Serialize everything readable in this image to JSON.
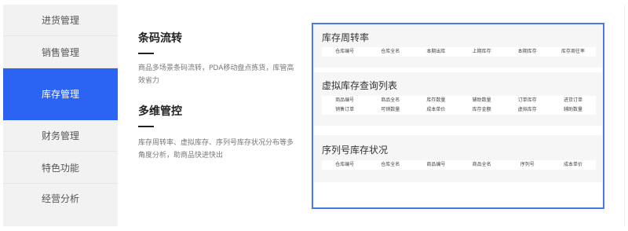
{
  "sidebar": {
    "items": [
      {
        "label": "进货管理"
      },
      {
        "label": "销售管理"
      },
      {
        "label": "库存管理"
      },
      {
        "label": "财务管理"
      },
      {
        "label": "特色功能"
      },
      {
        "label": "经营分析"
      }
    ],
    "active_label": "库存管理"
  },
  "features": [
    {
      "title": "条码流转",
      "desc": "商品多场景条码流转，PDA移动盘点拣货，库管高效省力"
    },
    {
      "title": "多维管控",
      "desc": "库存周转率、虚拟库存、序列号库存状况分布等多角度分析，助商品快进快出"
    }
  ],
  "reports": [
    {
      "title": "库存周转率",
      "rows": [
        [
          "仓库编号",
          "仓库全名",
          "本期出库",
          "上期库存",
          "本期库存",
          "库存周往率"
        ]
      ]
    },
    {
      "title": "虚拟库存查询列表",
      "rows": [
        [
          "商品编号",
          "商品全名",
          "库存数量",
          "辅助数量",
          "订单库存",
          "进货订单"
        ],
        [
          "销售订单",
          "可销数量",
          "成本单价",
          "库存金额",
          "虚拟库存",
          "辅助数量"
        ]
      ]
    },
    {
      "title": "序列号库存状况",
      "rows": [
        [
          "仓库编号",
          "仓库全名",
          "商品编号",
          "商品全名",
          "序列号",
          "成本单价"
        ]
      ]
    }
  ],
  "colors": {
    "accent": "#2b63f3",
    "panel_border": "#4a78e8",
    "sidebar_bg": "#f2f2f2"
  }
}
